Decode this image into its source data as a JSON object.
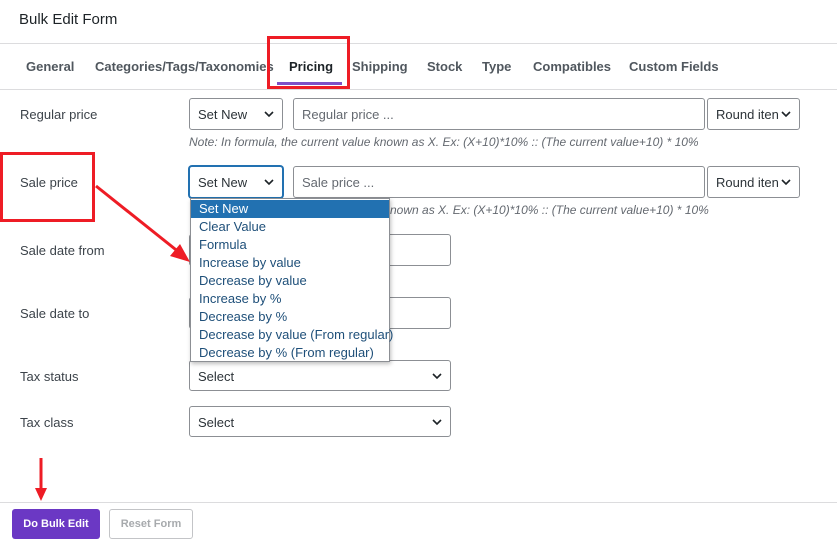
{
  "header": {
    "title": "Bulk Edit Form"
  },
  "tabs": [
    {
      "label": "General"
    },
    {
      "label": "Categories/Tags/Taxonomies"
    },
    {
      "label": "Pricing"
    },
    {
      "label": "Shipping"
    },
    {
      "label": "Stock"
    },
    {
      "label": "Type"
    },
    {
      "label": "Compatibles"
    },
    {
      "label": "Custom Fields"
    }
  ],
  "active_tab": "Pricing",
  "regular_price": {
    "label": "Regular price",
    "mode": "Set New",
    "placeholder": "Regular price ...",
    "round": "Round iten",
    "note": "Note: In formula, the current value known as X. Ex: (X+10)*10% :: (The current value+10) * 10%"
  },
  "sale_price": {
    "label": "Sale price",
    "mode": "Set New",
    "placeholder": "Sale price ...",
    "round": "Round iten",
    "note_visible": "nown as X. Ex: (X+10)*10% :: (The current value+10) * 10%"
  },
  "dropdown_options": [
    "Set New",
    "Clear Value",
    "Formula",
    "Increase by value",
    "Decrease by value",
    "Increase by %",
    "Decrease by %",
    "Decrease by value (From regular)",
    "Decrease by % (From regular)"
  ],
  "sale_date_from": {
    "label": "Sale date from"
  },
  "sale_date_to": {
    "label": "Sale date to"
  },
  "tax_status": {
    "label": "Tax status",
    "value": "Select"
  },
  "tax_class": {
    "label": "Tax class",
    "value": "Select"
  },
  "footer": {
    "primary": "Do Bulk Edit",
    "secondary": "Reset Form"
  },
  "colors": {
    "accent": "#7e50c7",
    "primary_button": "#6b38c4",
    "annotation": "#ee1c25",
    "dropdown_highlight": "#2271b1"
  }
}
